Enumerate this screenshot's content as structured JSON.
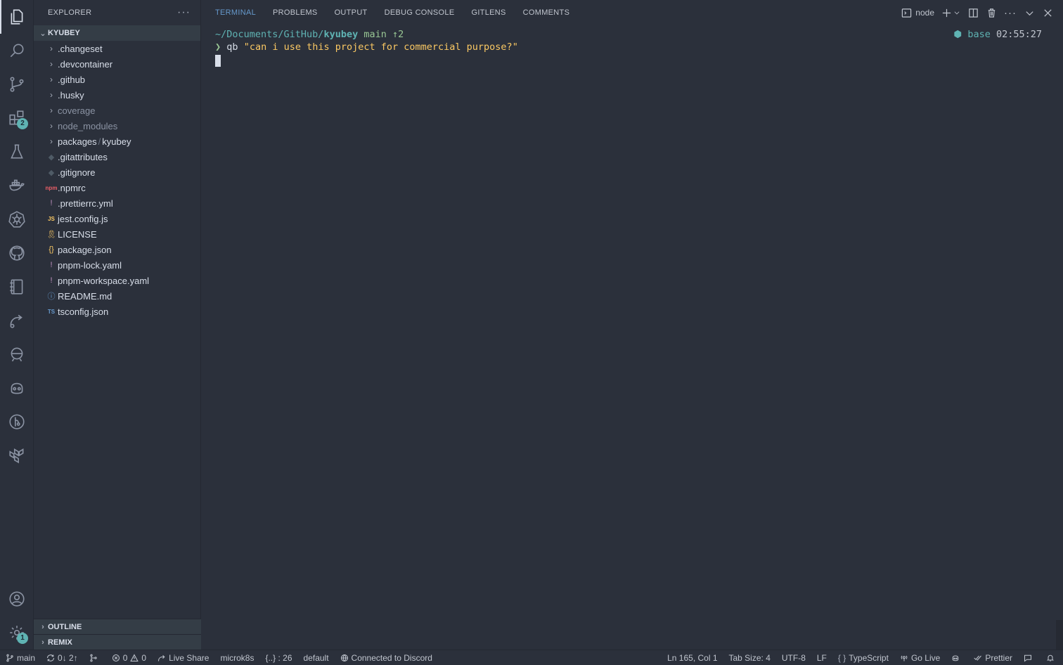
{
  "activity": {
    "items": [
      {
        "name": "explorer-icon"
      },
      {
        "name": "search-icon"
      },
      {
        "name": "source-control-icon"
      },
      {
        "name": "extensions-icon",
        "badge": "2"
      },
      {
        "name": "testing-icon"
      },
      {
        "name": "docker-icon"
      },
      {
        "name": "kubernetes-icon"
      },
      {
        "name": "github-icon"
      },
      {
        "name": "notebook-icon"
      },
      {
        "name": "remote-icon"
      },
      {
        "name": "gitlens-icon"
      },
      {
        "name": "copilot-icon"
      },
      {
        "name": "git-graph-icon"
      },
      {
        "name": "terraform-icon"
      }
    ],
    "accounts": {
      "name": "accounts-icon"
    },
    "settings": {
      "name": "settings-gear-icon",
      "badge": "1"
    }
  },
  "sidebar": {
    "title": "EXPLORER",
    "more": "···",
    "folder": "KYUBEY",
    "items": [
      {
        "label": ".changeset",
        "kind": "folder",
        "dim": false
      },
      {
        "label": ".devcontainer",
        "kind": "folder",
        "dim": false
      },
      {
        "label": ".github",
        "kind": "folder",
        "dim": false
      },
      {
        "label": ".husky",
        "kind": "folder",
        "dim": false
      },
      {
        "label": "coverage",
        "kind": "folder",
        "dim": true
      },
      {
        "label": "node_modules",
        "kind": "folder",
        "dim": true
      },
      {
        "label": "packages",
        "label2": "kyubey",
        "kind": "folder",
        "dim": false
      },
      {
        "label": ".gitattributes",
        "kind": "file",
        "icon": "◆",
        "iconColor": "#4f5b66"
      },
      {
        "label": ".gitignore",
        "kind": "file",
        "icon": "◆",
        "iconColor": "#4f5b66"
      },
      {
        "label": ".npmrc",
        "kind": "file",
        "icon": "npm",
        "iconColor": "#ec5f67"
      },
      {
        "label": ".prettierrc.yml",
        "kind": "file",
        "icon": "!",
        "iconColor": "#c594c5"
      },
      {
        "label": "jest.config.js",
        "kind": "file",
        "icon": "JS",
        "iconColor": "#fac863"
      },
      {
        "label": "LICENSE",
        "kind": "file",
        "icon": "🎗",
        "iconColor": "#fac863"
      },
      {
        "label": "package.json",
        "kind": "file",
        "icon": "{}",
        "iconColor": "#fac863"
      },
      {
        "label": "pnpm-lock.yaml",
        "kind": "file",
        "icon": "!",
        "iconColor": "#c594c5"
      },
      {
        "label": "pnpm-workspace.yaml",
        "kind": "file",
        "icon": "!",
        "iconColor": "#c594c5"
      },
      {
        "label": "README.md",
        "kind": "file",
        "icon": "ⓘ",
        "iconColor": "#6699cc"
      },
      {
        "label": "tsconfig.json",
        "kind": "file",
        "icon": "TS",
        "iconColor": "#6699cc"
      }
    ],
    "sections": {
      "outline": "OUTLINE",
      "remix": "REMIX"
    }
  },
  "panel": {
    "tabs": [
      "TERMINAL",
      "PROBLEMS",
      "OUTPUT",
      "DEBUG CONSOLE",
      "GITLENS",
      "COMMENTS"
    ],
    "active_tab": 0,
    "shell": "node"
  },
  "terminal": {
    "path": "~/Documents/GitHub/",
    "repo": "kyubey",
    "branch": "main ↑2",
    "env": "base",
    "time": "02:55:27",
    "prompt": "❯",
    "cmd_name": "qb",
    "cmd_arg": "\"can i use this project for commercial purpose?\""
  },
  "status": {
    "branch": "main",
    "sync": "0↓ 2↑",
    "errors": "0",
    "warnings": "0",
    "live_share": "Live Share",
    "k8s": "microk8s",
    "braces": "{..} : 26",
    "profile": "default",
    "discord": "Connected to Discord",
    "position": "Ln 165, Col 1",
    "tab_size": "Tab Size: 4",
    "encoding": "UTF-8",
    "eol": "LF",
    "language": "TypeScript",
    "go_live": "Go Live",
    "prettier": "Prettier"
  },
  "colors": {
    "background": "#2b303b",
    "accent": "#6699cc",
    "teal": "#5fb3b3",
    "green": "#99c794",
    "yellow": "#fac863"
  }
}
